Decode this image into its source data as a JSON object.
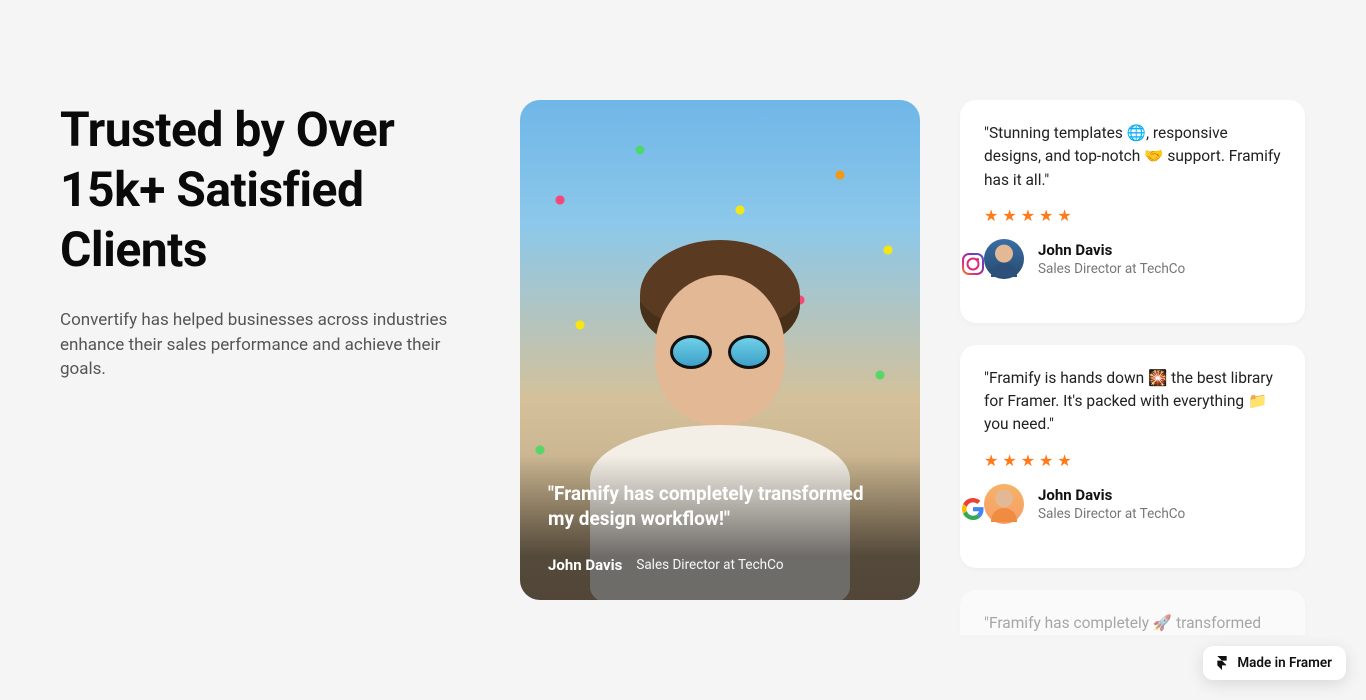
{
  "hero": {
    "headline": "Trusted by Over 15k+ Satisfied Clients",
    "subtext": "Convertify has helped businesses across industries enhance their sales performance and achieve their goals."
  },
  "featured": {
    "quote": "\"Framify has completely transformed my design workflow!\"",
    "author": "John Davis",
    "role": "Sales Director at TechCo"
  },
  "colors": {
    "star": "#ff7a1a"
  },
  "cards": [
    {
      "quote": "\"Stunning templates 🌐, responsive designs, and top-notch 🤝 support. Framify has it all.\"",
      "rating": 5,
      "author": "John Davis",
      "role": "Sales Director at TechCo",
      "source_icon": "instagram-icon"
    },
    {
      "quote": "\"Framify is hands down 🎇 the best library for Framer. It's packed with everything 📁 you need.\"",
      "rating": 5,
      "author": "John Davis",
      "role": "Sales Director at TechCo",
      "source_icon": "google-icon"
    }
  ],
  "peek_card": {
    "quote": "\"Framify has completely 🚀 transformed"
  },
  "badge": {
    "label": "Made in Framer"
  }
}
